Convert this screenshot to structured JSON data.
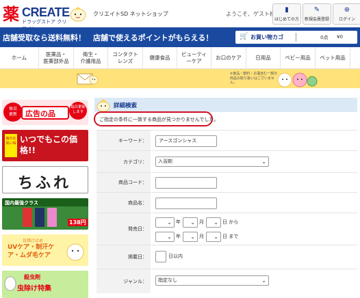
{
  "header": {
    "logo_kanji": "薬",
    "logo_brand": "CREATE",
    "logo_sub": "ドラッグストア クリエイト",
    "shop_name": "クリエイトSD ネットショップ",
    "welcome": "ようこそ、ゲスト様",
    "buttons": [
      {
        "icon": "book-icon",
        "glyph": "📖",
        "label": "はじめての方"
      },
      {
        "icon": "pencil-icon",
        "glyph": "✎",
        "label": "新規会員登録"
      },
      {
        "icon": "lock-icon",
        "glyph": "🔒",
        "label": "ログイン"
      }
    ]
  },
  "banner": {
    "message": "店舗受取なら送料無料！　店舗で使えるポイントがもらえる！",
    "cart_label": "お買い物カゴ",
    "cart_count": "0点",
    "cart_amount": "¥0"
  },
  "categories": [
    {
      "label": "ホーム",
      "w": 57
    },
    {
      "label": "医薬品・\n医薬部外品",
      "w": 51
    },
    {
      "label": "衛生・\n介護用品",
      "w": 50
    },
    {
      "label": "コンタクト\nレンズ",
      "w": 51
    },
    {
      "label": "健康食品",
      "w": 50
    },
    {
      "label": "ビューティ\nーケア",
      "w": 50
    },
    {
      "label": "お口のケア",
      "w": 51
    },
    {
      "label": "日用品",
      "w": 50
    },
    {
      "label": "ベビー用品",
      "w": 51
    },
    {
      "label": "ペット用品",
      "w": 51
    }
  ],
  "notice": {
    "text": "※食品・飲料・お酒含む一部の商品の取り扱いはございません。"
  },
  "side_banners": {
    "chirashi": "広告の品",
    "chirashi_tag": "毎日更新します",
    "itsudemo": "いつでもこの価格!!",
    "itsudemo_tag": "毎日お買い得",
    "chifure": "ちふれ",
    "kokunai": "国内最強クラス",
    "kokunai_price": "138円",
    "uv_small": "日焼け止め",
    "uv": "UVケア・制汗ケア・ムダ毛ケア",
    "insect_small": "殺虫剤",
    "insect": "虫除け特集"
  },
  "search": {
    "title": "詳細検索",
    "error": "ご指定の条件に一致する商品が見つかりませんでした。",
    "fields": {
      "keyword_label": "キーワード：",
      "keyword_value": "アースゴンシャス",
      "category_label": "カテゴリ：",
      "category_value": "入浴剤",
      "code_label": "商品コード：",
      "code_value": "",
      "name_label": "商品名：",
      "name_value": "",
      "release_label": "発売日：",
      "year_unit": "年",
      "month_unit": "月",
      "day_from": "日 から",
      "day_to": "日 まで",
      "published_label": "掲載日：",
      "within_days": "日以内",
      "genre_label": "ジャンル：",
      "genre_value": "指定なし"
    }
  },
  "colors": {
    "brand_blue": "#1a4aa0",
    "brand_red": "#e60012",
    "notice_yellow": "#ffe27a",
    "error_border": "#d01020"
  }
}
